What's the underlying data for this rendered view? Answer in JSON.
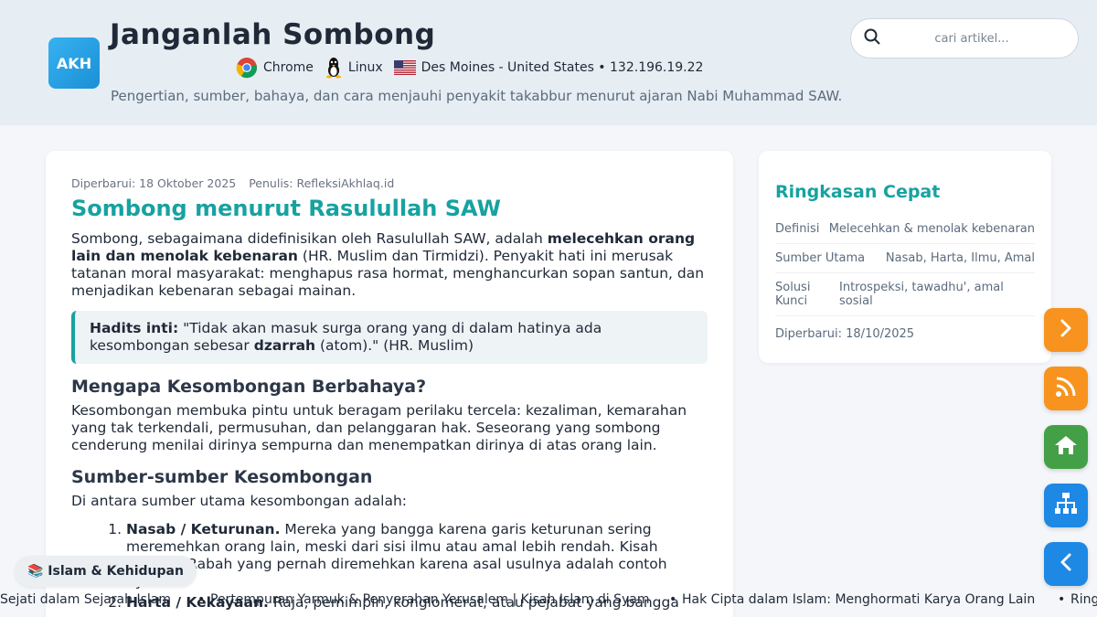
{
  "header": {
    "logo_text": "AKH",
    "title": "Janganlah Sombong",
    "browser": "Chrome",
    "os": "Linux",
    "location": "Des Moines - United States • 132.196.19.22",
    "subtitle": "Pengertian, sumber, bahaya, dan cara menjauhi penyakit takabbur menurut ajaran Nabi Muhammad SAW."
  },
  "search": {
    "placeholder": "cari artikel..."
  },
  "article": {
    "updated": "Diperbarui: 18 Oktober 2025",
    "author": "Penulis: RefleksiAkhlaq.id",
    "heading": "Sombong menurut Rasulullah SAW",
    "intro_pre": "Sombong, sebagaimana didefinisikan oleh Rasulullah SAW, adalah ",
    "intro_bold": "melecehkan orang lain dan menolak kebenaran",
    "intro_post": " (HR. Muslim dan Tirmidzi). Penyakit hati ini merusak tatanan moral masyarakat: menghapus rasa hormat, menghancurkan sopan santun, dan menjadikan kebenaran sebagai mainan.",
    "quote_label": "Hadits inti:",
    "quote_pre": " \"Tidak akan masuk surga orang yang di dalam hatinya ada kesombongan sebesar ",
    "quote_bold": "dzarrah",
    "quote_post": " (atom).\" (HR. Muslim)",
    "h2_danger": "Mengapa Kesombongan Berbahaya?",
    "danger_text": "Kesombongan membuka pintu untuk beragam perilaku tercela: kezaliman, kemarahan yang tak terkendali, permusuhan, dan pelanggaran hak. Seseorang yang sombong cenderung menilai dirinya sempurna dan menempatkan dirinya di atas orang lain.",
    "h2_sources": "Sumber-sumber Kesombongan",
    "sources_intro": "Di antara sumber utama kesombongan adalah:",
    "list": [
      {
        "bold": "Nasab / Keturunan.",
        "text": " Mereka yang bangga karena garis keturunan sering meremehkan orang lain, meski dari sisi ilmu atau amal lebih rendah. Kisah sahabat Rabah yang pernah diremehkan karena asal usulnya adalah contoh nyata."
      },
      {
        "bold": "Harta / Kekayaan.",
        "text": " Raja, pemimpin, konglomerat, atau pejabat yang bangga"
      }
    ]
  },
  "sidebar": {
    "title": "Ringkasan Cepat",
    "rows": [
      {
        "k": "Definisi",
        "v": "Melecehkan & menolak kebenaran"
      },
      {
        "k": "Sumber Utama",
        "v": "Nasab, Harta, Ilmu, Amal"
      },
      {
        "k": "Solusi Kunci",
        "v": "Introspeksi, tawadhu', amal sosial"
      }
    ],
    "updated": "Diperbarui: 18/10/2025"
  },
  "category_badge": "📚 Islam & Kehidupan",
  "ticker": [
    "Sejati dalam Sejarah Islam",
    "Pertempuran Yarmuk & Penyerahan Yerusalem | Kisah Islam di Syam",
    "Hak Cipta dalam Islam: Menghormati Karya Orang Lain",
    "Ring"
  ],
  "colors": {
    "accent": "#17a2a0",
    "next": "#f7931e",
    "rss": "#f7931e",
    "home": "#43a047",
    "sitemap": "#1e88e5",
    "back": "#1e88e5"
  },
  "icons": [
    "search-icon",
    "chrome-icon",
    "linux-icon",
    "us-flag-icon",
    "next-arrow-icon",
    "rss-icon",
    "home-icon",
    "sitemap-icon",
    "back-arrow-icon"
  ]
}
